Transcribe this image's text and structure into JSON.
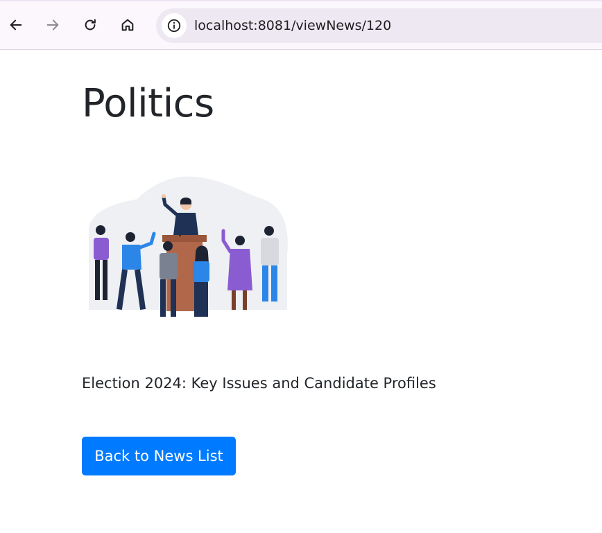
{
  "browser": {
    "url": "localhost:8081/viewNews/120",
    "back_icon": "arrow-left-icon",
    "forward_icon": "arrow-right-icon",
    "reload_icon": "reload-icon",
    "home_icon": "home-icon",
    "site_info_icon": "info-icon"
  },
  "page": {
    "title": "Politics",
    "image": "politics-rally-illustration",
    "headline": "Election 2024: Key Issues and Candidate Profiles",
    "back_button_label": "Back to News List"
  },
  "colors": {
    "toolbar_bg": "#fbf7fc",
    "omnibox_bg": "#eee8f3",
    "button_primary": "#007bff",
    "text_dark": "#212529"
  }
}
